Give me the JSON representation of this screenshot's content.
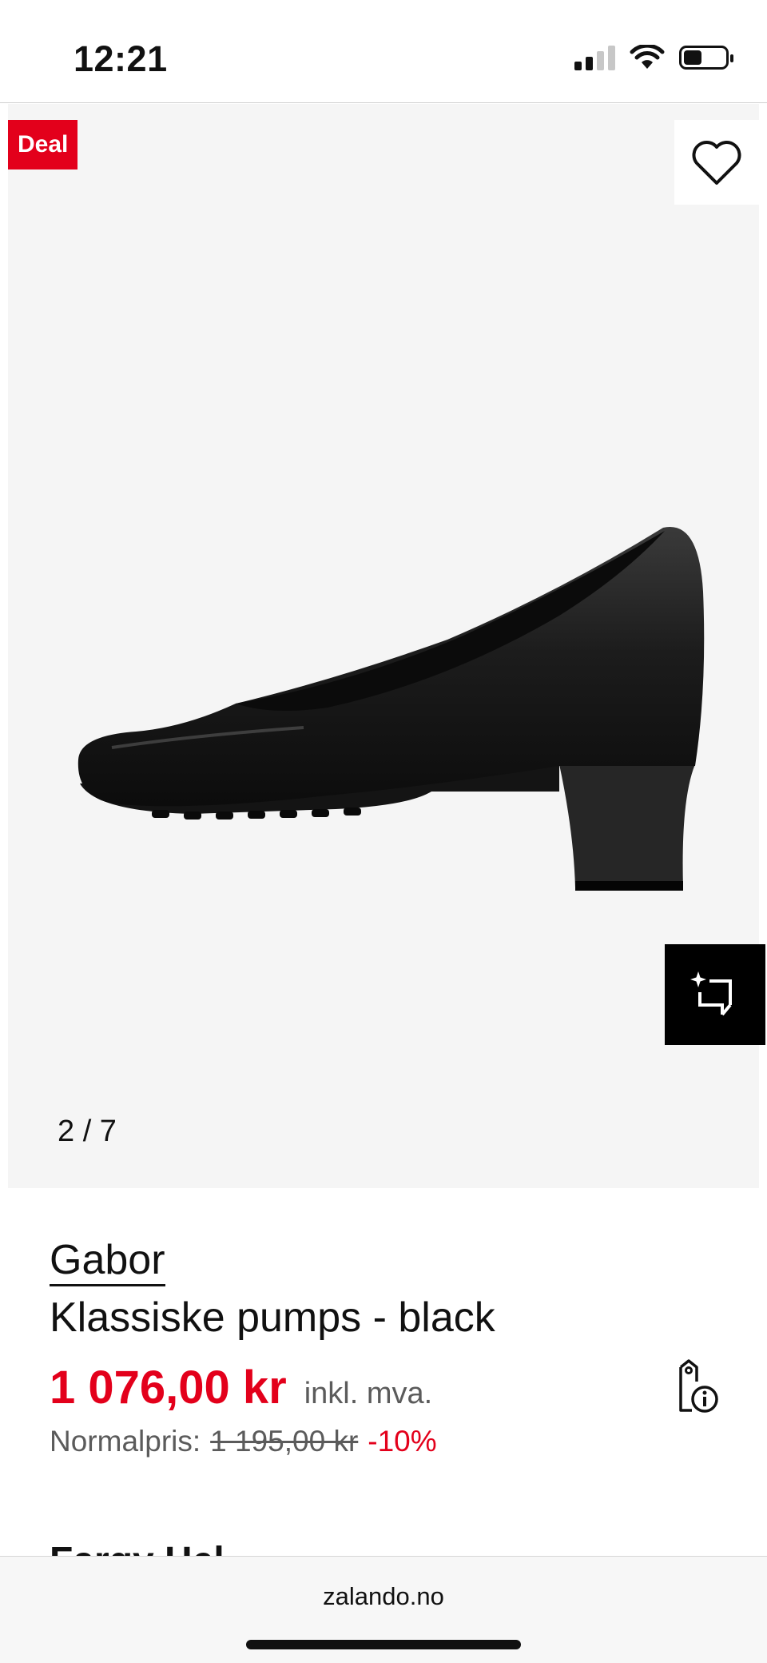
{
  "status_bar": {
    "time": "12:21"
  },
  "gallery": {
    "deal_badge": "Deal",
    "image_counter": "2 / 7",
    "image_subject": "black leather pump with block heel, side view",
    "wishlist_icon": "heart-icon",
    "ai_icon": "sparkle-crop-icon"
  },
  "product": {
    "brand": "Gabor",
    "name": "Klassiske pumps - black",
    "price": "1 076,00 kr",
    "vat_note": "inkl. mva.",
    "normal_label": "Normalpris:",
    "normal_price": "1 195,00 kr",
    "discount": "-10%",
    "price_info_icon": "price-tag-info-icon"
  },
  "next_section": {
    "heading": "Fargy Hel"
  },
  "browser": {
    "url": "zalando.no"
  },
  "colors": {
    "accent": "#e3001b",
    "gallery_bg": "#f5f5f5"
  }
}
